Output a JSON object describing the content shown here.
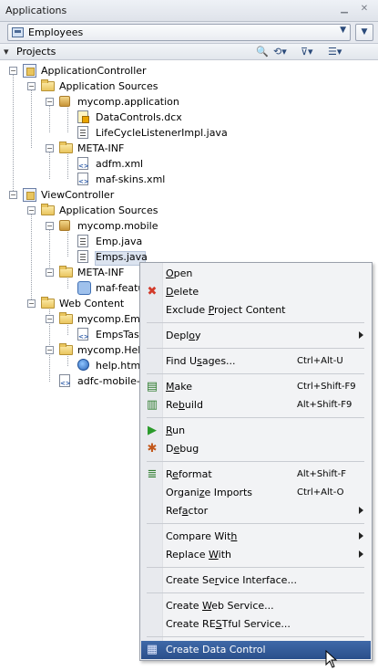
{
  "applications": {
    "title": "Applications",
    "selected_app": "Employees"
  },
  "projects": {
    "title": "Projects"
  },
  "tree": [
    {
      "label": "ApplicationController",
      "icon": "project-icon",
      "level": 0,
      "expanded": true
    },
    {
      "label": "Application Sources",
      "icon": "folder-icon",
      "level": 1,
      "expanded": true
    },
    {
      "label": "mycomp.application",
      "icon": "package-icon",
      "level": 2,
      "expanded": true
    },
    {
      "label": "DataControls.dcx",
      "icon": "dcx-file-icon",
      "level": 3
    },
    {
      "label": "LifeCycleListenerImpl.java",
      "icon": "java-file-icon",
      "level": 3
    },
    {
      "label": "META-INF",
      "icon": "folder-icon",
      "level": 2,
      "expanded": true
    },
    {
      "label": "adfm.xml",
      "icon": "xml-file-icon",
      "level": 3
    },
    {
      "label": "maf-skins.xml",
      "icon": "xml-file-icon",
      "level": 3
    },
    {
      "label": "ViewController",
      "icon": "project-icon",
      "level": 0,
      "expanded": true
    },
    {
      "label": "Application Sources",
      "icon": "folder-icon",
      "level": 1,
      "expanded": true
    },
    {
      "label": "mycomp.mobile",
      "icon": "package-icon",
      "level": 2,
      "expanded": true
    },
    {
      "label": "Emp.java",
      "icon": "java-file-icon",
      "level": 3
    },
    {
      "label": "Emps.java",
      "icon": "java-file-icon",
      "level": 3,
      "selected": true
    },
    {
      "label": "META-INF",
      "icon": "folder-icon",
      "level": 2,
      "expanded": true
    },
    {
      "label": "maf-featu",
      "icon": "feature-file-icon",
      "level": 3
    },
    {
      "label": "Web Content",
      "icon": "folder-icon",
      "level": 1,
      "expanded": true
    },
    {
      "label": "mycomp.Emplo",
      "icon": "folder-icon",
      "level": 2,
      "expanded": true
    },
    {
      "label": "EmpsTask",
      "icon": "task-flow-file-icon",
      "level": 3
    },
    {
      "label": "mycomp.Help",
      "icon": "folder-icon",
      "level": 2,
      "expanded": true
    },
    {
      "label": "help.html",
      "icon": "html-file-icon",
      "level": 3
    },
    {
      "label": "adfc-mobile-co",
      "icon": "xml-file-icon",
      "level": 2
    }
  ],
  "context_menu": [
    {
      "label": "Open",
      "mnemonic": 0
    },
    {
      "label": "Delete",
      "icon": "delete-icon",
      "mnemonic": 0
    },
    {
      "label": "Exclude Project Content",
      "mnemonic": 8
    },
    {
      "sep": true
    },
    {
      "label": "Deploy",
      "submenu": true,
      "mnemonic": 4
    },
    {
      "sep": true
    },
    {
      "label": "Find Usages...",
      "shortcut": "Ctrl+Alt-U",
      "mnemonic": 6
    },
    {
      "sep": true
    },
    {
      "label": "Make",
      "icon": "make-icon",
      "shortcut": "Ctrl+Shift-F9",
      "mnemonic": 0
    },
    {
      "label": "Rebuild",
      "icon": "rebuild-icon",
      "shortcut": "Alt+Shift-F9",
      "mnemonic": 2
    },
    {
      "sep": true
    },
    {
      "label": "Run",
      "icon": "run-icon",
      "mnemonic": 0
    },
    {
      "label": "Debug",
      "icon": "debug-icon",
      "mnemonic": 1
    },
    {
      "sep": true
    },
    {
      "label": "Reformat",
      "icon": "reformat-icon",
      "shortcut": "Alt+Shift-F",
      "mnemonic": 1
    },
    {
      "label": "Organize Imports",
      "shortcut": "Ctrl+Alt-O",
      "mnemonic": 6
    },
    {
      "label": "Refactor",
      "submenu": true,
      "mnemonic": 3
    },
    {
      "sep": true
    },
    {
      "label": "Compare With",
      "submenu": true,
      "mnemonic": 11
    },
    {
      "label": "Replace With",
      "submenu": true,
      "mnemonic": 8
    },
    {
      "sep": true
    },
    {
      "label": "Create Service Interface...",
      "mnemonic": 9
    },
    {
      "sep": true
    },
    {
      "label": "Create Web Service...",
      "mnemonic": 7
    },
    {
      "label": "Create RESTful Service...",
      "mnemonic": 9
    },
    {
      "sep": true
    },
    {
      "label": "Create Data Control",
      "icon": "data-control-icon",
      "highlighted": true
    }
  ],
  "colors": {
    "highlight": "#2a4f8b",
    "selection": "#dbe3ef"
  }
}
